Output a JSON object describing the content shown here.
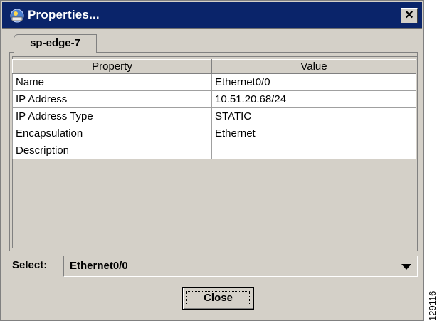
{
  "window": {
    "title": "Properties...",
    "close_glyph": "✕"
  },
  "tab": {
    "label": "sp-edge-7"
  },
  "table": {
    "headers": [
      "Property",
      "Value"
    ],
    "rows": [
      [
        "Name",
        "Ethernet0/0"
      ],
      [
        "IP Address",
        "10.51.20.68/24"
      ],
      [
        "IP Address Type",
        "STATIC"
      ],
      [
        "Encapsulation",
        "Ethernet"
      ],
      [
        "Description",
        ""
      ]
    ]
  },
  "select": {
    "label": "Select:",
    "value": "Ethernet0/0"
  },
  "footer": {
    "close_label": "Close"
  },
  "side_id": "129116",
  "colors": {
    "titlebar": "#0a246a",
    "window_bg": "#d4d0c8"
  }
}
